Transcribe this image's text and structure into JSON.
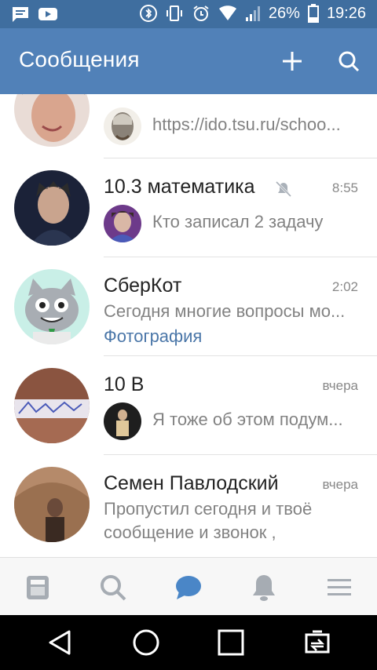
{
  "status_bar": {
    "battery": "26%",
    "time": "19:26",
    "left_icons": [
      "message-icon",
      "youtube-icon"
    ],
    "right_icons": [
      "bluetooth-icon",
      "vibrate-icon",
      "alarm-icon",
      "wifi-icon",
      "signal-icon",
      "battery-icon"
    ]
  },
  "header": {
    "title": "Сообщения",
    "add_icon": "plus-icon",
    "search_icon": "search-icon"
  },
  "conversations": [
    {
      "name": "",
      "time": "",
      "preview": "https://ido.tsu.ru/schoo...",
      "attachment": "",
      "muted": false
    },
    {
      "name": "10.3 математика",
      "time": "8:55",
      "preview": "Кто записал 2 задачу",
      "attachment": "",
      "muted": true
    },
    {
      "name": "СберКот",
      "time": "2:02",
      "preview": "Сегодня многие вопросы мо...",
      "attachment": "Фотография",
      "muted": false
    },
    {
      "name": "10 В",
      "time": "вчера",
      "preview": "Я тоже об этом подум...",
      "attachment": "",
      "muted": false
    },
    {
      "name": "Семен Павлодский",
      "time": "вчера",
      "preview_line1": "Пропустил сегодня и твоё",
      "preview_line2": "сообщение и звонок ,",
      "attachment": "",
      "muted": false
    }
  ],
  "tab_bar": {
    "tabs": [
      "news-icon",
      "search-icon",
      "messages-icon",
      "notifications-icon",
      "menu-icon"
    ],
    "active_tab": "messages-icon",
    "active_color": "#4a86c7",
    "inactive_color": "#a6acb3"
  },
  "nav_bar": {
    "buttons": [
      "back-icon",
      "home-icon",
      "recents-icon",
      "screen-mirror-icon"
    ]
  },
  "colors": {
    "status_bar": "#3f6e9f",
    "app_bar": "#5181b8",
    "link": "#4a76a8"
  }
}
